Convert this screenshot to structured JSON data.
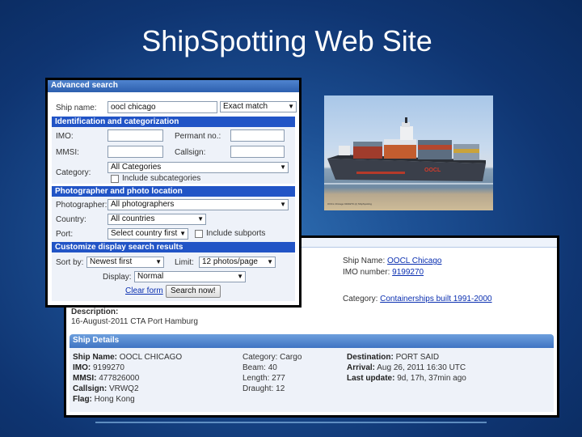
{
  "slide": {
    "title": "ShipSpotting Web Site"
  },
  "search_form": {
    "title": "Advanced search",
    "ship_name_label": "Ship name:",
    "ship_name_value": "oocl chicago",
    "match_mode": "Exact match",
    "section_identification": "Identification and categorization",
    "imo_label": "IMO:",
    "permanent_label": "Permant no.:",
    "mmsi_label": "MMSI:",
    "callsign_label": "Callsign:",
    "category_label": "Category:",
    "category_value": "All Categories",
    "include_subcategories": "Include subcategories",
    "section_photo": "Photographer and photo location",
    "photographer_label": "Photographer:",
    "photographer_value": "All photographers",
    "country_label": "Country:",
    "country_value": "All countries",
    "port_label": "Port:",
    "port_value": "Select country first",
    "include_subports": "Include subports",
    "section_display": "Customize display search results",
    "sort_label": "Sort by:",
    "sort_value": "Newest first",
    "limit_label": "Limit:",
    "limit_value": "12 photos/page",
    "display_label": "Display:",
    "display_value": "Normal",
    "clear_label": "Clear form",
    "search_label": "Search now!"
  },
  "photo": {
    "hull_text": "OOCL",
    "credit": "OOCL Chicago 9199270 (c) ShipSpotting"
  },
  "ship_page": {
    "ship_name_label": "Ship Name:",
    "ship_name_link": "OOCL Chicago",
    "imo_label": "IMO number:",
    "imo_link": "9199270",
    "category_label": "Category:",
    "category_link": "Containerships built 1991-2000",
    "description_label": "Description:",
    "description_value": "16-August-2011 CTA Port Hamburg",
    "details_header": "Ship Details",
    "col1": {
      "name_label": "Ship Name:",
      "name_value": "OOCL CHICAGO",
      "imo_label": "IMO:",
      "imo_value": "9199270",
      "mmsi_label": "MMSI:",
      "mmsi_value": "477826000",
      "callsign_label": "Callsign:",
      "callsign_value": "VRWQ2",
      "flag_label": "Flag:",
      "flag_value": "Hong Kong"
    },
    "col2": {
      "category_label": "Category:",
      "category_value": "Cargo",
      "beam_label": "Beam:",
      "beam_value": "40",
      "length_label": "Length:",
      "length_value": "277",
      "draught_label": "Draught:",
      "draught_value": "12"
    },
    "col3": {
      "destination_label": "Destination:",
      "destination_value": "PORT SAID",
      "arrival_label": "Arrival:",
      "arrival_value": "Aug 26, 2011 16:30 UTC",
      "update_label": "Last update:",
      "update_value": "9d, 17h, 37min ago"
    }
  },
  "colors": {
    "accent": "#2154c6",
    "link": "#0a2fb0",
    "hull": "#3a3f4a",
    "brand_text": "#d23b2b"
  }
}
